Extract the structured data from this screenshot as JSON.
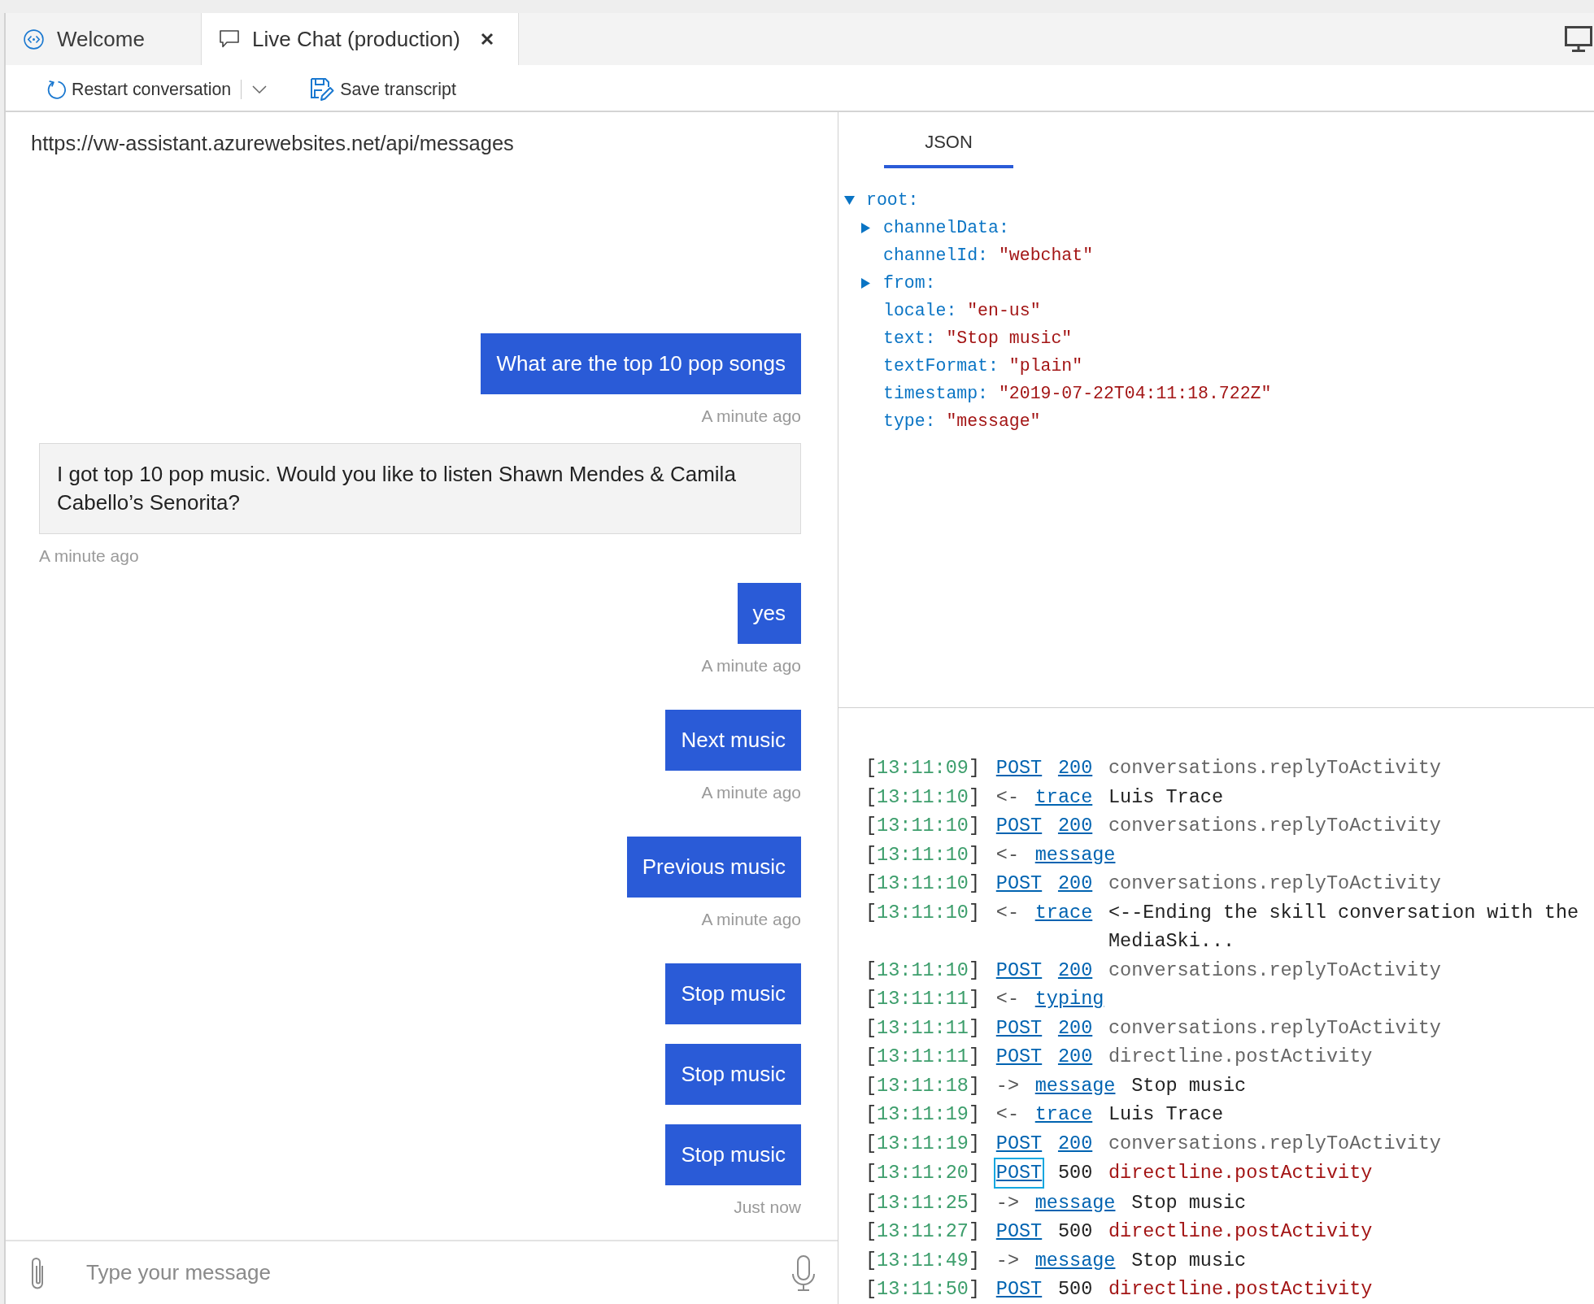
{
  "tabs": [
    {
      "kind": "welcome",
      "label": "Welcome",
      "selected": false,
      "closable": false
    },
    {
      "kind": "chat",
      "label": "Live Chat (production)",
      "selected": true,
      "closable": true
    }
  ],
  "toolbar": [
    {
      "kind": "restart",
      "label": "Restart conversation",
      "has_menu": true
    },
    {
      "kind": "save",
      "label": "Save transcript",
      "has_menu": false
    }
  ],
  "chat": {
    "endpoint": "https://vw-assistant.azurewebsites.net/api/messages",
    "messages": [
      {
        "kind": "user",
        "text": "What are the top 10 pop songs",
        "time": "A minute ago"
      },
      {
        "kind": "bot",
        "text": "I got top 10 pop music. Would you like to listen Shawn Mendes & Camila Cabello’s Senorita?",
        "time": "A minute ago"
      },
      {
        "kind": "user",
        "text": "yes",
        "time": "A minute ago"
      },
      {
        "kind": "user",
        "text": "Next music",
        "time": "A minute ago"
      },
      {
        "kind": "user",
        "text": "Previous music",
        "time": "A minute ago"
      },
      {
        "kind": "user",
        "text": "Stop music"
      },
      {
        "kind": "user",
        "text": "Stop music"
      },
      {
        "kind": "user",
        "text": "Stop music",
        "time": "Just now"
      }
    ],
    "input": {
      "placeholder": "Type your message"
    }
  },
  "inspector": {
    "tabs": [
      {
        "label": "JSON",
        "selected": true
      }
    ],
    "tree": [
      {
        "kind": "object",
        "key": "root:",
        "expanded": true,
        "children": [
          {
            "kind": "object",
            "key": "channelData:",
            "expanded": false
          },
          {
            "kind": "value",
            "key": "channelId:",
            "value": "\"webchat\""
          },
          {
            "kind": "object",
            "key": "from:",
            "expanded": false
          },
          {
            "kind": "value",
            "key": "locale:",
            "value": "\"en-us\""
          },
          {
            "kind": "value",
            "key": "text:",
            "value": "\"Stop music\""
          },
          {
            "kind": "value",
            "key": "textFormat:",
            "value": "\"plain\""
          },
          {
            "kind": "value",
            "key": "timestamp:",
            "value": "\"2019-07-22T04:11:18.722Z\""
          },
          {
            "kind": "value",
            "key": "type:",
            "value": "\"message\""
          }
        ]
      }
    ]
  },
  "log": [
    {
      "kind": "request",
      "time": "[13:11:09]",
      "method": "POST",
      "status": "200",
      "route": "conversations.replyToActivity",
      "error": false,
      "focused": false
    },
    {
      "kind": "activity",
      "time": "[13:11:10]",
      "direction": "<-",
      "type": "trace",
      "text": "Luis Trace",
      "focused": false
    },
    {
      "kind": "request",
      "time": "[13:11:10]",
      "method": "POST",
      "status": "200",
      "route": "conversations.replyToActivity",
      "error": false,
      "focused": false
    },
    {
      "kind": "activity",
      "time": "[13:11:10]",
      "direction": "<-",
      "type": "message",
      "focused": false
    },
    {
      "kind": "request",
      "time": "[13:11:10]",
      "method": "POST",
      "status": "200",
      "route": "conversations.replyToActivity",
      "error": false,
      "focused": false
    },
    {
      "kind": "activity",
      "time": "[13:11:10]",
      "direction": "<-",
      "type": "trace",
      "text": "<--Ending the skill conversation with the MediaSki...",
      "focused": false
    },
    {
      "kind": "request",
      "time": "[13:11:10]",
      "method": "POST",
      "status": "200",
      "route": "conversations.replyToActivity",
      "error": false,
      "focused": false
    },
    {
      "kind": "activity",
      "time": "[13:11:11]",
      "direction": "<-",
      "type": "typing",
      "focused": false
    },
    {
      "kind": "request",
      "time": "[13:11:11]",
      "method": "POST",
      "status": "200",
      "route": "conversations.replyToActivity",
      "error": false,
      "focused": false
    },
    {
      "kind": "request",
      "time": "[13:11:11]",
      "method": "POST",
      "status": "200",
      "route": "directline.postActivity",
      "error": false,
      "focused": false
    },
    {
      "kind": "activity",
      "time": "[13:11:18]",
      "direction": "->",
      "type": "message",
      "text": "Stop music",
      "focused": false
    },
    {
      "kind": "activity",
      "time": "[13:11:19]",
      "direction": "<-",
      "type": "trace",
      "text": "Luis Trace",
      "focused": false
    },
    {
      "kind": "request",
      "time": "[13:11:19]",
      "method": "POST",
      "status": "200",
      "route": "conversations.replyToActivity",
      "error": false,
      "focused": false
    },
    {
      "kind": "request",
      "time": "[13:11:20]",
      "method": "POST",
      "status": "500",
      "route": "directline.postActivity",
      "error": true,
      "focused": true
    },
    {
      "kind": "activity",
      "time": "[13:11:25]",
      "direction": "->",
      "type": "message",
      "text": "Stop music",
      "focused": false
    },
    {
      "kind": "request",
      "time": "[13:11:27]",
      "method": "POST",
      "status": "500",
      "route": "directline.postActivity",
      "error": true,
      "focused": false
    },
    {
      "kind": "activity",
      "time": "[13:11:49]",
      "direction": "->",
      "type": "message",
      "text": "Stop music",
      "focused": false
    },
    {
      "kind": "request",
      "time": "[13:11:50]",
      "method": "POST",
      "status": "500",
      "route": "directline.postActivity",
      "error": true,
      "focused": false
    }
  ]
}
